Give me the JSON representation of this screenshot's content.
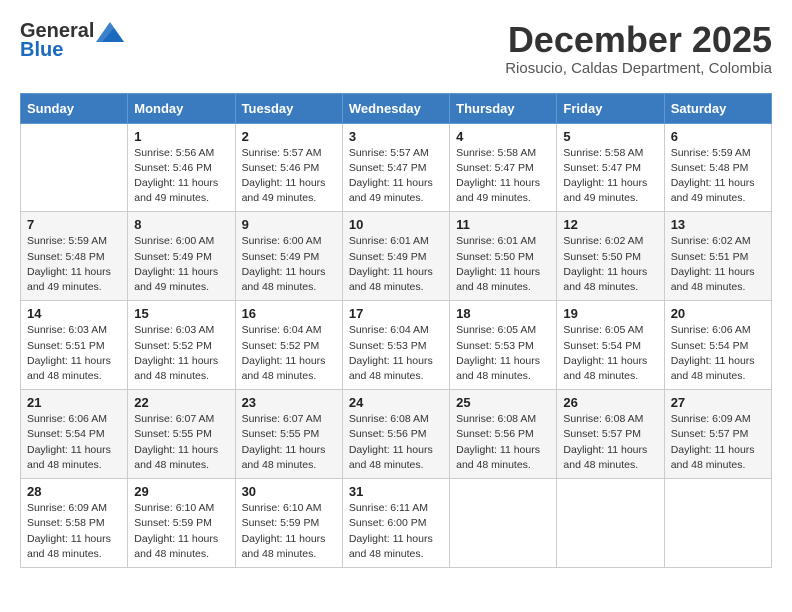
{
  "header": {
    "logo_general": "General",
    "logo_blue": "Blue",
    "month_title": "December 2025",
    "location": "Riosucio, Caldas Department, Colombia"
  },
  "days_of_week": [
    "Sunday",
    "Monday",
    "Tuesday",
    "Wednesday",
    "Thursday",
    "Friday",
    "Saturday"
  ],
  "weeks": [
    [
      {
        "day": "",
        "sunrise": "",
        "sunset": "",
        "daylight": ""
      },
      {
        "day": "1",
        "sunrise": "Sunrise: 5:56 AM",
        "sunset": "Sunset: 5:46 PM",
        "daylight": "Daylight: 11 hours and 49 minutes."
      },
      {
        "day": "2",
        "sunrise": "Sunrise: 5:57 AM",
        "sunset": "Sunset: 5:46 PM",
        "daylight": "Daylight: 11 hours and 49 minutes."
      },
      {
        "day": "3",
        "sunrise": "Sunrise: 5:57 AM",
        "sunset": "Sunset: 5:47 PM",
        "daylight": "Daylight: 11 hours and 49 minutes."
      },
      {
        "day": "4",
        "sunrise": "Sunrise: 5:58 AM",
        "sunset": "Sunset: 5:47 PM",
        "daylight": "Daylight: 11 hours and 49 minutes."
      },
      {
        "day": "5",
        "sunrise": "Sunrise: 5:58 AM",
        "sunset": "Sunset: 5:47 PM",
        "daylight": "Daylight: 11 hours and 49 minutes."
      },
      {
        "day": "6",
        "sunrise": "Sunrise: 5:59 AM",
        "sunset": "Sunset: 5:48 PM",
        "daylight": "Daylight: 11 hours and 49 minutes."
      }
    ],
    [
      {
        "day": "7",
        "sunrise": "Sunrise: 5:59 AM",
        "sunset": "Sunset: 5:48 PM",
        "daylight": "Daylight: 11 hours and 49 minutes."
      },
      {
        "day": "8",
        "sunrise": "Sunrise: 6:00 AM",
        "sunset": "Sunset: 5:49 PM",
        "daylight": "Daylight: 11 hours and 49 minutes."
      },
      {
        "day": "9",
        "sunrise": "Sunrise: 6:00 AM",
        "sunset": "Sunset: 5:49 PM",
        "daylight": "Daylight: 11 hours and 48 minutes."
      },
      {
        "day": "10",
        "sunrise": "Sunrise: 6:01 AM",
        "sunset": "Sunset: 5:49 PM",
        "daylight": "Daylight: 11 hours and 48 minutes."
      },
      {
        "day": "11",
        "sunrise": "Sunrise: 6:01 AM",
        "sunset": "Sunset: 5:50 PM",
        "daylight": "Daylight: 11 hours and 48 minutes."
      },
      {
        "day": "12",
        "sunrise": "Sunrise: 6:02 AM",
        "sunset": "Sunset: 5:50 PM",
        "daylight": "Daylight: 11 hours and 48 minutes."
      },
      {
        "day": "13",
        "sunrise": "Sunrise: 6:02 AM",
        "sunset": "Sunset: 5:51 PM",
        "daylight": "Daylight: 11 hours and 48 minutes."
      }
    ],
    [
      {
        "day": "14",
        "sunrise": "Sunrise: 6:03 AM",
        "sunset": "Sunset: 5:51 PM",
        "daylight": "Daylight: 11 hours and 48 minutes."
      },
      {
        "day": "15",
        "sunrise": "Sunrise: 6:03 AM",
        "sunset": "Sunset: 5:52 PM",
        "daylight": "Daylight: 11 hours and 48 minutes."
      },
      {
        "day": "16",
        "sunrise": "Sunrise: 6:04 AM",
        "sunset": "Sunset: 5:52 PM",
        "daylight": "Daylight: 11 hours and 48 minutes."
      },
      {
        "day": "17",
        "sunrise": "Sunrise: 6:04 AM",
        "sunset": "Sunset: 5:53 PM",
        "daylight": "Daylight: 11 hours and 48 minutes."
      },
      {
        "day": "18",
        "sunrise": "Sunrise: 6:05 AM",
        "sunset": "Sunset: 5:53 PM",
        "daylight": "Daylight: 11 hours and 48 minutes."
      },
      {
        "day": "19",
        "sunrise": "Sunrise: 6:05 AM",
        "sunset": "Sunset: 5:54 PM",
        "daylight": "Daylight: 11 hours and 48 minutes."
      },
      {
        "day": "20",
        "sunrise": "Sunrise: 6:06 AM",
        "sunset": "Sunset: 5:54 PM",
        "daylight": "Daylight: 11 hours and 48 minutes."
      }
    ],
    [
      {
        "day": "21",
        "sunrise": "Sunrise: 6:06 AM",
        "sunset": "Sunset: 5:54 PM",
        "daylight": "Daylight: 11 hours and 48 minutes."
      },
      {
        "day": "22",
        "sunrise": "Sunrise: 6:07 AM",
        "sunset": "Sunset: 5:55 PM",
        "daylight": "Daylight: 11 hours and 48 minutes."
      },
      {
        "day": "23",
        "sunrise": "Sunrise: 6:07 AM",
        "sunset": "Sunset: 5:55 PM",
        "daylight": "Daylight: 11 hours and 48 minutes."
      },
      {
        "day": "24",
        "sunrise": "Sunrise: 6:08 AM",
        "sunset": "Sunset: 5:56 PM",
        "daylight": "Daylight: 11 hours and 48 minutes."
      },
      {
        "day": "25",
        "sunrise": "Sunrise: 6:08 AM",
        "sunset": "Sunset: 5:56 PM",
        "daylight": "Daylight: 11 hours and 48 minutes."
      },
      {
        "day": "26",
        "sunrise": "Sunrise: 6:08 AM",
        "sunset": "Sunset: 5:57 PM",
        "daylight": "Daylight: 11 hours and 48 minutes."
      },
      {
        "day": "27",
        "sunrise": "Sunrise: 6:09 AM",
        "sunset": "Sunset: 5:57 PM",
        "daylight": "Daylight: 11 hours and 48 minutes."
      }
    ],
    [
      {
        "day": "28",
        "sunrise": "Sunrise: 6:09 AM",
        "sunset": "Sunset: 5:58 PM",
        "daylight": "Daylight: 11 hours and 48 minutes."
      },
      {
        "day": "29",
        "sunrise": "Sunrise: 6:10 AM",
        "sunset": "Sunset: 5:59 PM",
        "daylight": "Daylight: 11 hours and 48 minutes."
      },
      {
        "day": "30",
        "sunrise": "Sunrise: 6:10 AM",
        "sunset": "Sunset: 5:59 PM",
        "daylight": "Daylight: 11 hours and 48 minutes."
      },
      {
        "day": "31",
        "sunrise": "Sunrise: 6:11 AM",
        "sunset": "Sunset: 6:00 PM",
        "daylight": "Daylight: 11 hours and 48 minutes."
      },
      {
        "day": "",
        "sunrise": "",
        "sunset": "",
        "daylight": ""
      },
      {
        "day": "",
        "sunrise": "",
        "sunset": "",
        "daylight": ""
      },
      {
        "day": "",
        "sunrise": "",
        "sunset": "",
        "daylight": ""
      }
    ]
  ]
}
